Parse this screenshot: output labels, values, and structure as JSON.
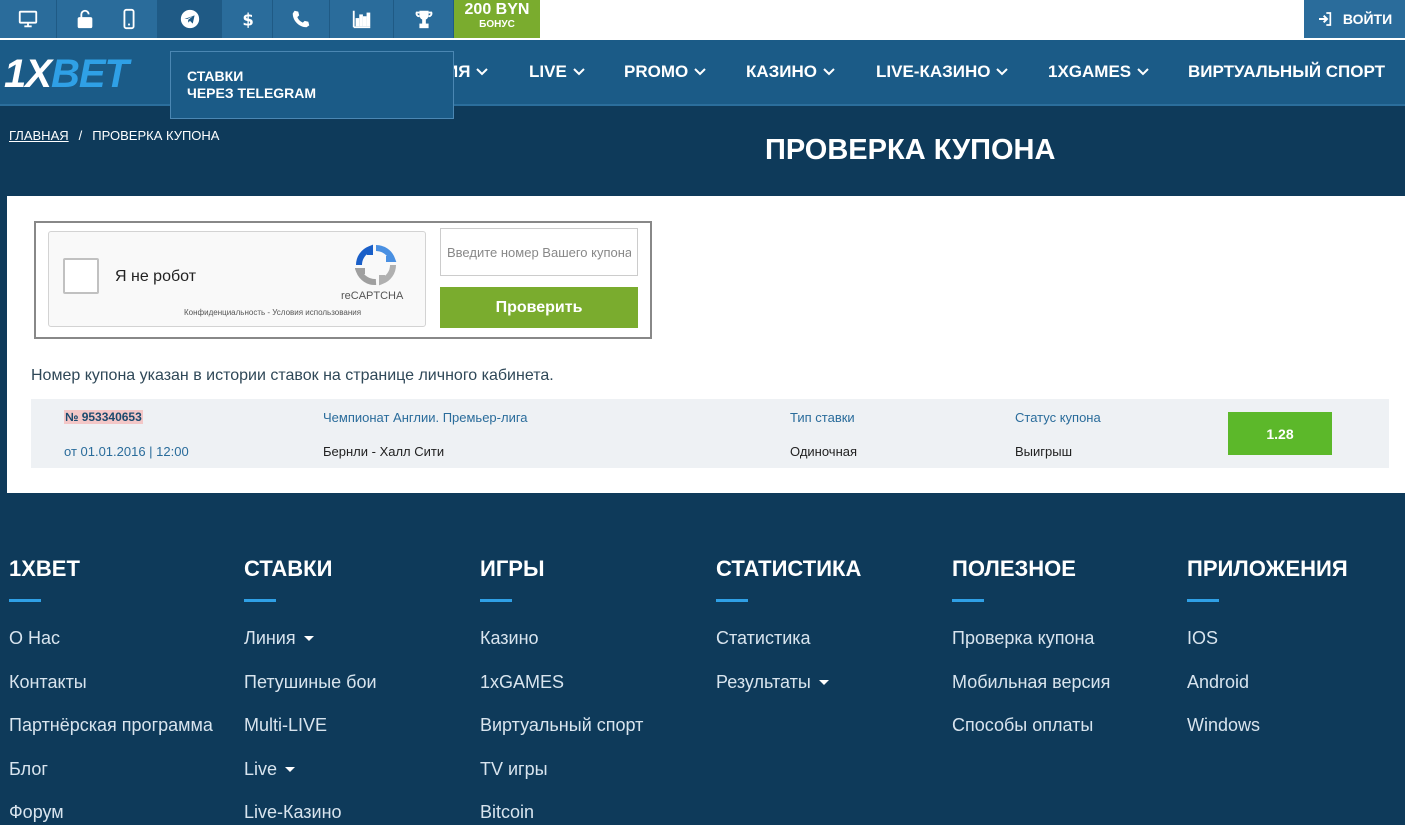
{
  "topbar": {
    "icons": [
      "desktop-icon",
      "lock-icon",
      "mobile-icon",
      "telegram-icon",
      "dollar-icon",
      "phone-icon",
      "chart-icon",
      "trophy-icon"
    ],
    "bonus_amount": "200 BYN",
    "bonus_label": "БОНУС",
    "login_label": "ВОЙТИ"
  },
  "logo": {
    "part1": "1X",
    "part2": "BET"
  },
  "nav": {
    "items": [
      {
        "label": "ЛИНИЯ",
        "has_dropdown": true
      },
      {
        "label": "LIVE",
        "has_dropdown": true
      },
      {
        "label": "PROMO",
        "has_dropdown": true
      },
      {
        "label": "КАЗИНО",
        "has_dropdown": true
      },
      {
        "label": "LIVE-КАЗИНО",
        "has_dropdown": true
      },
      {
        "label": "1XGAMES",
        "has_dropdown": true
      },
      {
        "label": "ВИРТУАЛЬНЫЙ СПОРТ",
        "has_dropdown": false
      }
    ],
    "visible_partial_item": "ИЯ"
  },
  "tooltip": {
    "line1": "СТАВКИ",
    "line2": "ЧЕРЕЗ TELEGRAM"
  },
  "breadcrumb": {
    "home": "ГЛАВНАЯ",
    "separator": "/",
    "current": "ПРОВЕРКА КУПОНА"
  },
  "page": {
    "title": "ПРОВЕРКА КУПОНА"
  },
  "form": {
    "captcha_label": "Я не робот",
    "captcha_brand": "reCAPTCHA",
    "captcha_links": "Конфиденциальность - Условия использования",
    "coupon_placeholder": "Введите номер Вашего купона",
    "check_button": "Проверить"
  },
  "hint": "Номер купона указан в истории ставок на странице личного кабинета.",
  "result": {
    "number": "№ 953340653",
    "date": "от 01.01.2016 | 12:00",
    "championship": "Чемпионат Англии. Премьер-лига",
    "match": "Бернли - Халл Сити",
    "bet_type_header": "Тип ставки",
    "bet_type": "Одиночная",
    "status_header": "Статус купона",
    "status": "Выигрыш",
    "odds": "1.28"
  },
  "footer": {
    "columns": [
      {
        "title": "1XBET",
        "items": [
          {
            "label": "О Нас"
          },
          {
            "label": "Контакты"
          },
          {
            "label": "Партнёрская программа"
          },
          {
            "label": "Блог"
          },
          {
            "label": "Форум"
          }
        ]
      },
      {
        "title": "СТАВКИ",
        "items": [
          {
            "label": "Линия",
            "caret": true
          },
          {
            "label": "Петушиные бои"
          },
          {
            "label": "Multi-LIVE"
          },
          {
            "label": "Live",
            "caret": true
          },
          {
            "label": "Live-Казино"
          }
        ]
      },
      {
        "title": "ИГРЫ",
        "items": [
          {
            "label": "Казино"
          },
          {
            "label": "1xGAMES"
          },
          {
            "label": "Виртуальный спорт"
          },
          {
            "label": "TV игры"
          },
          {
            "label": "Bitcoin"
          }
        ]
      },
      {
        "title": "СТАТИСТИКА",
        "items": [
          {
            "label": "Статистика"
          },
          {
            "label": "Результаты",
            "caret": true
          }
        ]
      },
      {
        "title": "ПОЛЕЗНОЕ",
        "items": [
          {
            "label": "Проверка купона"
          },
          {
            "label": "Мобильная версия"
          },
          {
            "label": "Способы оплаты"
          }
        ]
      },
      {
        "title": "ПРИЛОЖЕНИЯ",
        "items": [
          {
            "label": "IOS"
          },
          {
            "label": "Android"
          },
          {
            "label": "Windows"
          }
        ]
      }
    ]
  },
  "colors": {
    "topbar_blue": "#2a6c9b",
    "nav_blue": "#1b5b87",
    "dark_blue": "#0e3a5a",
    "bonus_green": "#7aac2e",
    "odds_green": "#5cb82a",
    "accent_blue": "#2fa0e6"
  }
}
